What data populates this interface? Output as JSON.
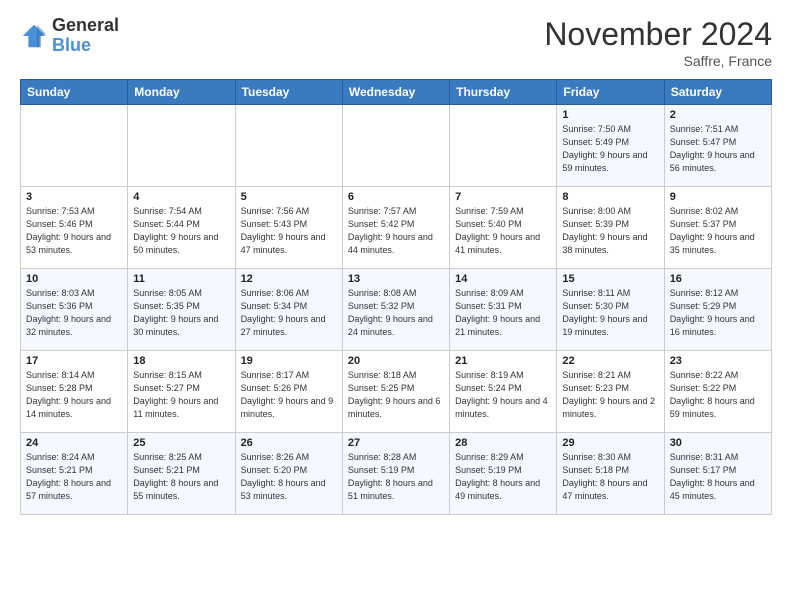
{
  "header": {
    "logo_line1": "General",
    "logo_line2": "Blue",
    "month": "November 2024",
    "location": "Saffre, France"
  },
  "days_of_week": [
    "Sunday",
    "Monday",
    "Tuesday",
    "Wednesday",
    "Thursday",
    "Friday",
    "Saturday"
  ],
  "weeks": [
    [
      {
        "day": "",
        "info": ""
      },
      {
        "day": "",
        "info": ""
      },
      {
        "day": "",
        "info": ""
      },
      {
        "day": "",
        "info": ""
      },
      {
        "day": "",
        "info": ""
      },
      {
        "day": "1",
        "info": "Sunrise: 7:50 AM\nSunset: 5:49 PM\nDaylight: 9 hours and 59 minutes."
      },
      {
        "day": "2",
        "info": "Sunrise: 7:51 AM\nSunset: 5:47 PM\nDaylight: 9 hours and 56 minutes."
      }
    ],
    [
      {
        "day": "3",
        "info": "Sunrise: 7:53 AM\nSunset: 5:46 PM\nDaylight: 9 hours and 53 minutes."
      },
      {
        "day": "4",
        "info": "Sunrise: 7:54 AM\nSunset: 5:44 PM\nDaylight: 9 hours and 50 minutes."
      },
      {
        "day": "5",
        "info": "Sunrise: 7:56 AM\nSunset: 5:43 PM\nDaylight: 9 hours and 47 minutes."
      },
      {
        "day": "6",
        "info": "Sunrise: 7:57 AM\nSunset: 5:42 PM\nDaylight: 9 hours and 44 minutes."
      },
      {
        "day": "7",
        "info": "Sunrise: 7:59 AM\nSunset: 5:40 PM\nDaylight: 9 hours and 41 minutes."
      },
      {
        "day": "8",
        "info": "Sunrise: 8:00 AM\nSunset: 5:39 PM\nDaylight: 9 hours and 38 minutes."
      },
      {
        "day": "9",
        "info": "Sunrise: 8:02 AM\nSunset: 5:37 PM\nDaylight: 9 hours and 35 minutes."
      }
    ],
    [
      {
        "day": "10",
        "info": "Sunrise: 8:03 AM\nSunset: 5:36 PM\nDaylight: 9 hours and 32 minutes."
      },
      {
        "day": "11",
        "info": "Sunrise: 8:05 AM\nSunset: 5:35 PM\nDaylight: 9 hours and 30 minutes."
      },
      {
        "day": "12",
        "info": "Sunrise: 8:06 AM\nSunset: 5:34 PM\nDaylight: 9 hours and 27 minutes."
      },
      {
        "day": "13",
        "info": "Sunrise: 8:08 AM\nSunset: 5:32 PM\nDaylight: 9 hours and 24 minutes."
      },
      {
        "day": "14",
        "info": "Sunrise: 8:09 AM\nSunset: 5:31 PM\nDaylight: 9 hours and 21 minutes."
      },
      {
        "day": "15",
        "info": "Sunrise: 8:11 AM\nSunset: 5:30 PM\nDaylight: 9 hours and 19 minutes."
      },
      {
        "day": "16",
        "info": "Sunrise: 8:12 AM\nSunset: 5:29 PM\nDaylight: 9 hours and 16 minutes."
      }
    ],
    [
      {
        "day": "17",
        "info": "Sunrise: 8:14 AM\nSunset: 5:28 PM\nDaylight: 9 hours and 14 minutes."
      },
      {
        "day": "18",
        "info": "Sunrise: 8:15 AM\nSunset: 5:27 PM\nDaylight: 9 hours and 11 minutes."
      },
      {
        "day": "19",
        "info": "Sunrise: 8:17 AM\nSunset: 5:26 PM\nDaylight: 9 hours and 9 minutes."
      },
      {
        "day": "20",
        "info": "Sunrise: 8:18 AM\nSunset: 5:25 PM\nDaylight: 9 hours and 6 minutes."
      },
      {
        "day": "21",
        "info": "Sunrise: 8:19 AM\nSunset: 5:24 PM\nDaylight: 9 hours and 4 minutes."
      },
      {
        "day": "22",
        "info": "Sunrise: 8:21 AM\nSunset: 5:23 PM\nDaylight: 9 hours and 2 minutes."
      },
      {
        "day": "23",
        "info": "Sunrise: 8:22 AM\nSunset: 5:22 PM\nDaylight: 8 hours and 59 minutes."
      }
    ],
    [
      {
        "day": "24",
        "info": "Sunrise: 8:24 AM\nSunset: 5:21 PM\nDaylight: 8 hours and 57 minutes."
      },
      {
        "day": "25",
        "info": "Sunrise: 8:25 AM\nSunset: 5:21 PM\nDaylight: 8 hours and 55 minutes."
      },
      {
        "day": "26",
        "info": "Sunrise: 8:26 AM\nSunset: 5:20 PM\nDaylight: 8 hours and 53 minutes."
      },
      {
        "day": "27",
        "info": "Sunrise: 8:28 AM\nSunset: 5:19 PM\nDaylight: 8 hours and 51 minutes."
      },
      {
        "day": "28",
        "info": "Sunrise: 8:29 AM\nSunset: 5:19 PM\nDaylight: 8 hours and 49 minutes."
      },
      {
        "day": "29",
        "info": "Sunrise: 8:30 AM\nSunset: 5:18 PM\nDaylight: 8 hours and 47 minutes."
      },
      {
        "day": "30",
        "info": "Sunrise: 8:31 AM\nSunset: 5:17 PM\nDaylight: 8 hours and 45 minutes."
      }
    ]
  ]
}
